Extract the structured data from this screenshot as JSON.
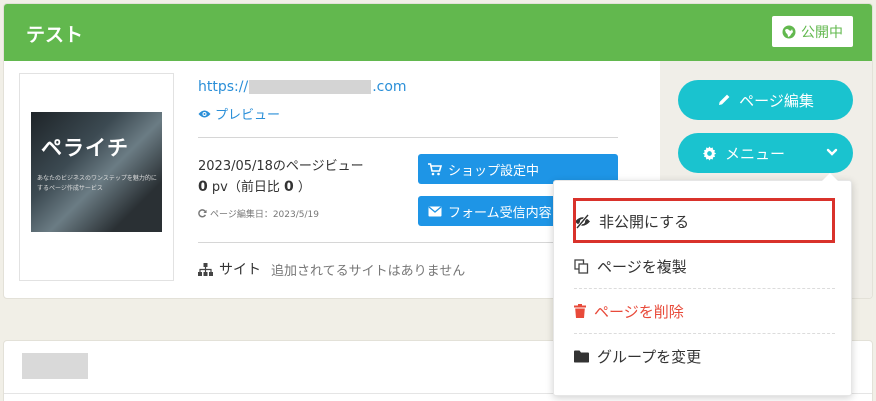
{
  "card": {
    "title": "テスト",
    "status_badge": "公開中",
    "url_prefix": "https://",
    "url_suffix": ".com",
    "preview_label": "プレビュー",
    "thumbnail": {
      "title": "ペライチ",
      "caption": "あなたのビジネスのワンステップを魅力的にするページ作成サービス"
    },
    "pageview": {
      "date_label": "2023/05/18のページビュー",
      "count": "0",
      "unit_open": " pv（前日比 ",
      "diff": "0",
      "unit_close": " ）"
    },
    "edit_date": "ページ編集日：2023/5/19",
    "shop_button": "ショップ設定中",
    "form_button": "フォーム受信内容",
    "site_label": "サイト",
    "site_note": "追加されてるサイトはありません"
  },
  "actions": {
    "edit_button": "ページ編集",
    "menu_button": "メニュー"
  },
  "dropdown": {
    "items": [
      {
        "label": "非公開にする",
        "icon": "eye-slash-icon"
      },
      {
        "label": "ページを複製",
        "icon": "copy-icon"
      },
      {
        "label": "ページを削除",
        "icon": "trash-icon"
      },
      {
        "label": "グループを変更",
        "icon": "folder-icon"
      }
    ]
  },
  "colors": {
    "header_green": "#62b84e",
    "teal": "#1ac3cf",
    "blue": "#1e95e6",
    "danger": "#e84a3a",
    "highlight": "#d9322b"
  }
}
